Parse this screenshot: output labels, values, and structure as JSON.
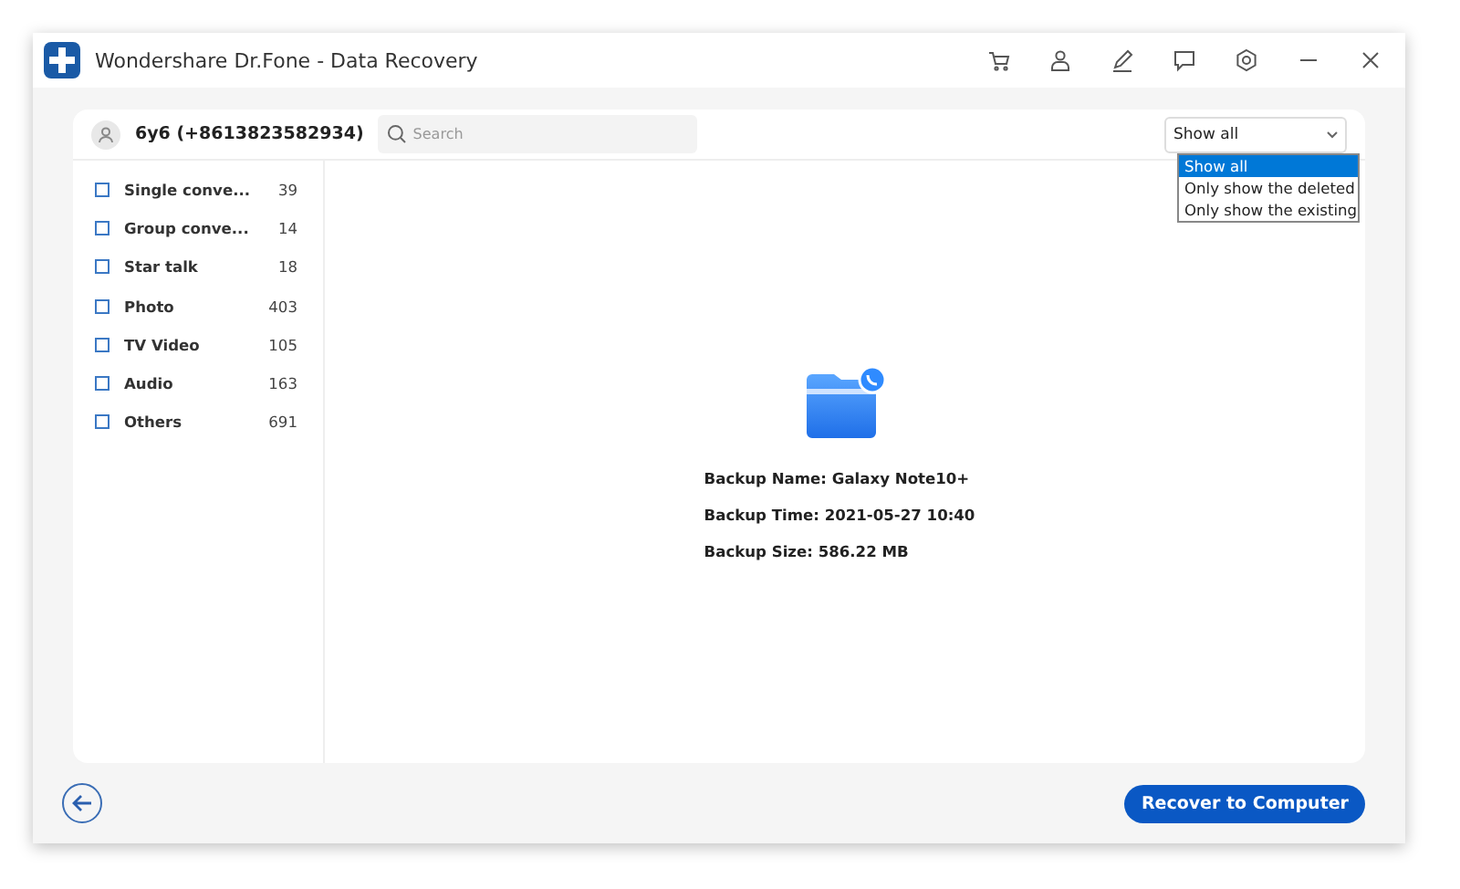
{
  "window": {
    "title": "Wondershare Dr.Fone - Data Recovery"
  },
  "account": {
    "name": "6y6 (+8613823582934)"
  },
  "search": {
    "placeholder": "Search"
  },
  "filter": {
    "value": "Show all",
    "expanded": true,
    "options": [
      {
        "label": "Show all",
        "selected": true
      },
      {
        "label": "Only show the deleted",
        "selected": false
      },
      {
        "label": "Only show the existing",
        "selected": false
      }
    ]
  },
  "categories": [
    {
      "label": "Single conve...",
      "count": "39",
      "checked": false
    },
    {
      "label": "Group conve...",
      "count": "14",
      "checked": false
    },
    {
      "label": "Star talk",
      "count": "18",
      "checked": false
    },
    {
      "label": "Photo",
      "count": "403",
      "checked": false
    },
    {
      "label": "TV Video",
      "count": "105",
      "checked": false
    },
    {
      "label": "Audio",
      "count": "163",
      "checked": false
    },
    {
      "label": "Others",
      "count": "691",
      "checked": false
    }
  ],
  "backup": [
    "Backup Name: Galaxy Note10+",
    "Backup Time: 2021-05-27 10:40",
    "Backup Size: 586.22 MB"
  ],
  "recover_button": "Recover to Computer"
}
